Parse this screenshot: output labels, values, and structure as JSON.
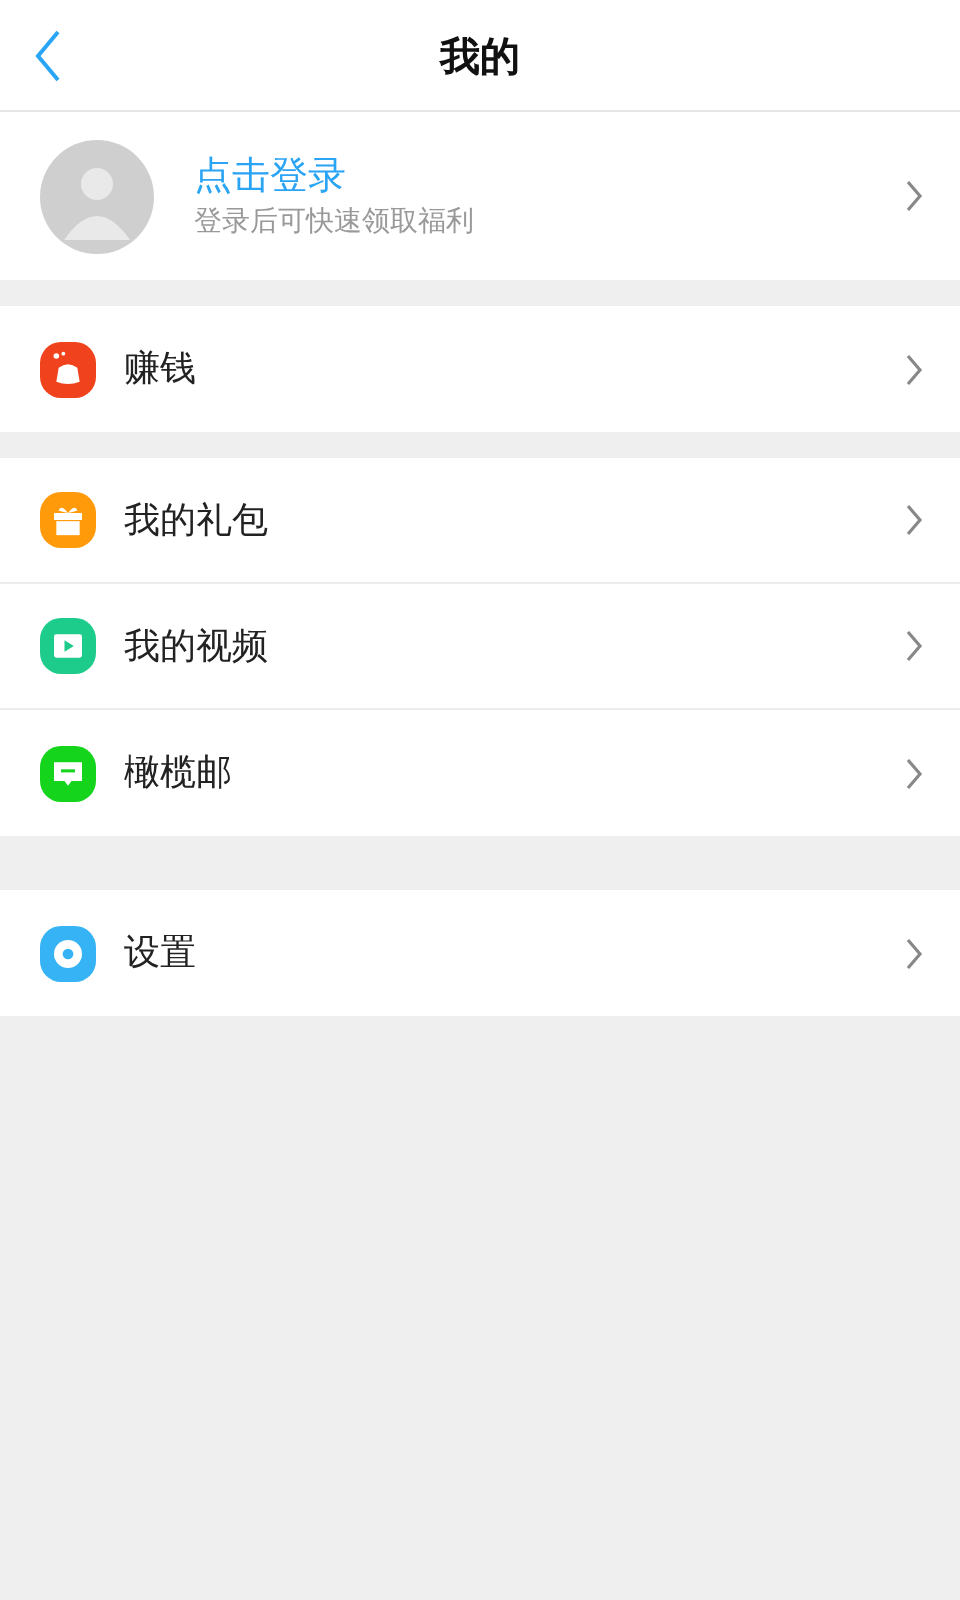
{
  "header": {
    "title": "我的"
  },
  "profile": {
    "name": "点击登录",
    "subtitle": "登录后可快速领取福利"
  },
  "groups": [
    [
      {
        "label": "赚钱",
        "kind": "money",
        "color": "#f0421c"
      }
    ],
    [
      {
        "label": "我的礼包",
        "kind": "gift",
        "color": "#ff9a0a"
      },
      {
        "label": "我的视频",
        "kind": "video",
        "color": "#1dcc8a"
      },
      {
        "label": "橄榄邮",
        "kind": "message",
        "color": "#14d41c"
      }
    ],
    [
      {
        "label": "设置",
        "kind": "gear",
        "color": "#36b3f5"
      }
    ]
  ]
}
